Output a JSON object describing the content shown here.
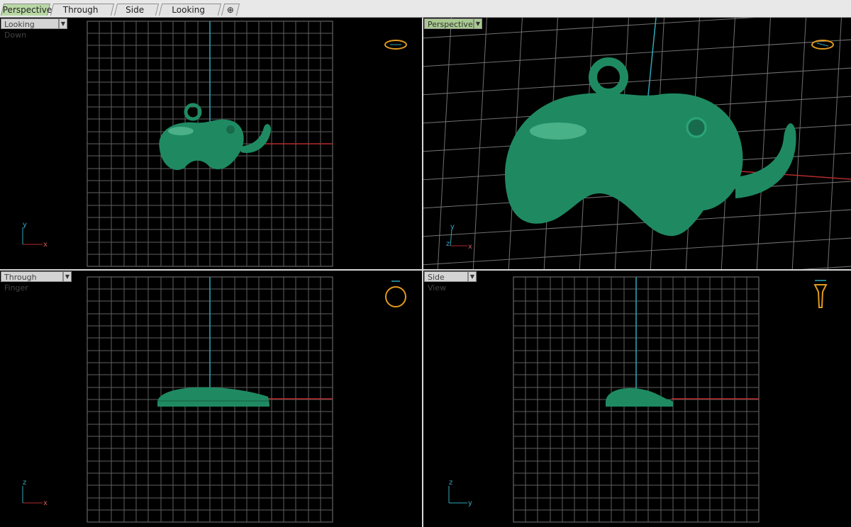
{
  "tabs": [
    {
      "label": "Perspective",
      "active": true
    },
    {
      "label": "Through Finger",
      "active": false
    },
    {
      "label": "Side View",
      "active": false
    },
    {
      "label": "Looking Down",
      "active": false
    }
  ],
  "add_tab_symbol": "⊕",
  "viewports": {
    "looking_down": {
      "label": "Looking Down",
      "axis_h": "x",
      "axis_v": "y"
    },
    "perspective": {
      "label": "Perspective",
      "axis_h": "x",
      "axis_v": "y",
      "axis_z": "z"
    },
    "through_finger": {
      "label": "Through Finger",
      "axis_h": "x",
      "axis_v": "z"
    },
    "side_view": {
      "label": "Side View",
      "axis_h": "y",
      "axis_v": "z"
    }
  },
  "dropdown_glyph": "▼",
  "colors": {
    "model": "#1f8a62",
    "grid": "#6a6a6a",
    "x_axis": "#b52a2a",
    "y_axis": "#2fa7b8",
    "active_label": "#a8c98f"
  }
}
